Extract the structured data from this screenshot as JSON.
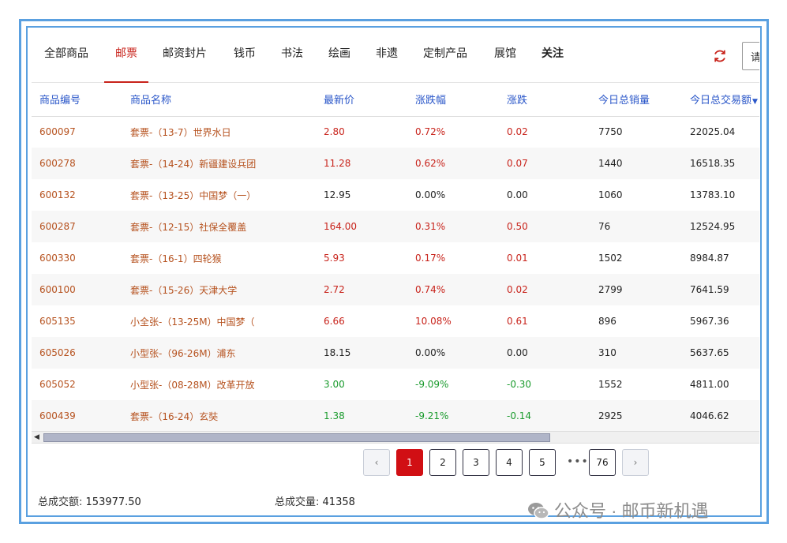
{
  "tabs": [
    {
      "label": "全部商品"
    },
    {
      "label": "邮票"
    },
    {
      "label": "邮资封片"
    },
    {
      "label": "钱币"
    },
    {
      "label": "书法"
    },
    {
      "label": "绘画"
    },
    {
      "label": "非遗"
    },
    {
      "label": "定制产品"
    },
    {
      "label": "展馆"
    },
    {
      "label": "关注"
    }
  ],
  "active_tab": "邮票",
  "search": {
    "text": "请"
  },
  "table": {
    "headers": [
      "商品编号",
      "商品名称",
      "最新价",
      "涨跌幅",
      "涨跌",
      "今日总销量",
      "今日总交易额"
    ],
    "rows": [
      {
        "code": "600097",
        "name": "套票-（13-7）世界水日",
        "price": "2.80",
        "pct": "0.72%",
        "chg": "0.02",
        "vol": "7750",
        "amt": "22025.04",
        "trend": "up"
      },
      {
        "code": "600278",
        "name": "套票-（14-24）新疆建设兵团",
        "price": "11.28",
        "pct": "0.62%",
        "chg": "0.07",
        "vol": "1440",
        "amt": "16518.35",
        "trend": "up"
      },
      {
        "code": "600132",
        "name": "套票-（13-25）中国梦（一）",
        "price": "12.95",
        "pct": "0.00%",
        "chg": "0.00",
        "vol": "1060",
        "amt": "13783.10",
        "trend": "neutral"
      },
      {
        "code": "600287",
        "name": "套票-（12-15）社保全覆盖",
        "price": "164.00",
        "pct": "0.31%",
        "chg": "0.50",
        "vol": "76",
        "amt": "12524.95",
        "trend": "up"
      },
      {
        "code": "600330",
        "name": "套票-（16-1）四轮猴",
        "price": "5.93",
        "pct": "0.17%",
        "chg": "0.01",
        "vol": "1502",
        "amt": "8984.87",
        "trend": "up"
      },
      {
        "code": "600100",
        "name": "套票-（15-26）天津大学",
        "price": "2.72",
        "pct": "0.74%",
        "chg": "0.02",
        "vol": "2799",
        "amt": "7641.59",
        "trend": "up"
      },
      {
        "code": "605135",
        "name": "小全张-（13-25M）中国梦（",
        "price": "6.66",
        "pct": "10.08%",
        "chg": "0.61",
        "vol": "896",
        "amt": "5967.36",
        "trend": "up"
      },
      {
        "code": "605026",
        "name": "小型张-（96-26M）浦东",
        "price": "18.15",
        "pct": "0.00%",
        "chg": "0.00",
        "vol": "310",
        "amt": "5637.65",
        "trend": "neutral"
      },
      {
        "code": "605052",
        "name": "小型张-（08-28M）改革开放",
        "price": "3.00",
        "pct": "-9.09%",
        "chg": "-0.30",
        "vol": "1552",
        "amt": "4811.00",
        "trend": "down"
      },
      {
        "code": "600439",
        "name": "套票-（16-24）玄奘",
        "price": "1.38",
        "pct": "-9.21%",
        "chg": "-0.14",
        "vol": "2925",
        "amt": "4046.62",
        "trend": "down"
      }
    ]
  },
  "pagination": {
    "pages": [
      "1",
      "2",
      "3",
      "4",
      "5"
    ],
    "ellipsis": "•••",
    "last": "76",
    "current": "1",
    "prev": "‹",
    "next": "›"
  },
  "footer": {
    "amount_label": "总成交额:",
    "amount": "153977.50",
    "volume_label": "总成交量:",
    "volume": "41358"
  },
  "watermark": {
    "text": "公众号 · 邮币新机遇"
  },
  "icons": {
    "refresh": "refresh-icon",
    "wechat": "wechat-icon"
  },
  "colors": {
    "up": "#c8231b",
    "down": "#1a9b2d",
    "accent": "#d10f14",
    "header_text": "#2b57c9",
    "frame": "#5aa0e0"
  }
}
